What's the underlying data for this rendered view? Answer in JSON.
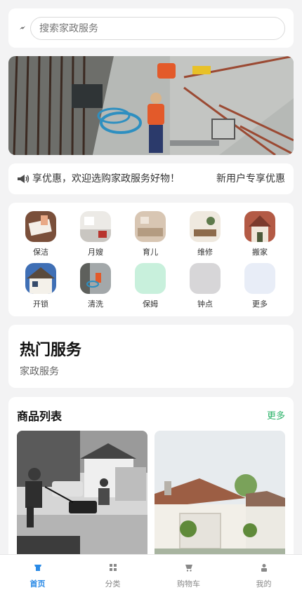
{
  "search": {
    "placeholder": "搜索家政服务"
  },
  "banner": {
    "image": "construction-site-photo"
  },
  "notice": {
    "text": "享优惠，欢迎选购家政服务好物！",
    "right_label": "新用户专享优惠"
  },
  "categories": [
    {
      "label": "保洁",
      "icon": "cleaning-photo"
    },
    {
      "label": "月嫂",
      "icon": "kitchen-photo"
    },
    {
      "label": "育儿",
      "icon": "living-room-photo"
    },
    {
      "label": "维修",
      "icon": "interior-photo"
    },
    {
      "label": "搬家",
      "icon": "house-facade-photo"
    },
    {
      "label": "开锁",
      "icon": "house-photo"
    },
    {
      "label": "清洗",
      "icon": "workers-photo"
    },
    {
      "label": "保姆",
      "icon": "mint-placeholder",
      "color": "#c8f0dc"
    },
    {
      "label": "钟点",
      "icon": "grey-placeholder",
      "color": "#d7d6d8"
    },
    {
      "label": "更多",
      "icon": "light-blue-placeholder",
      "color": "#e8edf7"
    }
  ],
  "hot": {
    "title": "热门服务",
    "subtitle": "家政服务"
  },
  "goods": {
    "title": "商品列表",
    "more_label": "更多",
    "items": [
      {
        "image": "lawn-mowing-photo"
      },
      {
        "image": "garage-house-photo"
      }
    ]
  },
  "tabbar": {
    "items": [
      {
        "label": "首页",
        "icon": "home-icon",
        "active": true
      },
      {
        "label": "分类",
        "icon": "grid-icon",
        "active": false
      },
      {
        "label": "购物车",
        "icon": "cart-icon",
        "active": false
      },
      {
        "label": "我的",
        "icon": "user-icon",
        "active": false
      }
    ]
  },
  "colors": {
    "accent_blue": "#2a8ae6",
    "more_green": "#2db36a",
    "background": "#f3f3f4"
  }
}
